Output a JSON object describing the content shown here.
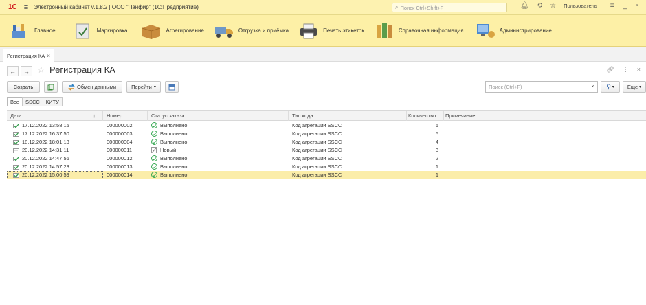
{
  "titlebar": {
    "logo": "1С",
    "title": "Электронный кабинет v.1.8.2 | ООО \"Панфир\" (1С:Предприятие)",
    "search_placeholder": "Поиск Ctrl+Shift+F",
    "user_label": "Пользователь"
  },
  "sections": [
    {
      "label": "Главное",
      "icon": "home-section-icon"
    },
    {
      "label": "Маркировка",
      "icon": "marking-section-icon"
    },
    {
      "label": "Агрегирование",
      "icon": "box-section-icon"
    },
    {
      "label": "Отгрузка и приёмка",
      "icon": "truck-section-icon"
    },
    {
      "label": "Печать этикеток",
      "icon": "printer-section-icon"
    },
    {
      "label": "Справочная информация",
      "icon": "books-section-icon"
    },
    {
      "label": "Администрирование",
      "icon": "admin-section-icon"
    }
  ],
  "tabs": [
    {
      "label": "Регистрация КА",
      "close": "×"
    }
  ],
  "form": {
    "title": "Регистрация КА",
    "back": "←",
    "forward": "→"
  },
  "toolbar": {
    "create": "Создать",
    "exchange": "Обмен данными",
    "goto": "Перейти",
    "search_placeholder": "Поиск (Ctrl+F)",
    "more": "Еще",
    "clear": "×"
  },
  "filters": [
    "Все",
    "SSCC",
    "КИТУ"
  ],
  "table": {
    "columns": [
      "Дата",
      "Номер",
      "Статус заказа",
      "Тип кода",
      "Количество",
      "Примечание"
    ],
    "sort_mark": "↓",
    "rows": [
      {
        "date": "17.12.2022 13:58:15",
        "number": "000000002",
        "status": "Выполнено",
        "status_kind": "done",
        "code_type": "Код агрегации SSCC",
        "qty": "5",
        "note": ""
      },
      {
        "date": "17.12.2022 16:37:50",
        "number": "000000003",
        "status": "Выполнено",
        "status_kind": "done",
        "code_type": "Код агрегации SSCC",
        "qty": "5",
        "note": ""
      },
      {
        "date": "18.12.2022 18:01:13",
        "number": "000000004",
        "status": "Выполнено",
        "status_kind": "done",
        "code_type": "Код агрегации SSCC",
        "qty": "4",
        "note": ""
      },
      {
        "date": "20.12.2022 14:31:11",
        "number": "000000011",
        "status": "Новый",
        "status_kind": "new",
        "code_type": "Код агрегации SSCC",
        "qty": "3",
        "note": ""
      },
      {
        "date": "20.12.2022 14:47:56",
        "number": "000000012",
        "status": "Выполнено",
        "status_kind": "done",
        "code_type": "Код агрегации SSCC",
        "qty": "2",
        "note": ""
      },
      {
        "date": "20.12.2022 14:57:23",
        "number": "000000013",
        "status": "Выполнено",
        "status_kind": "done",
        "code_type": "Код агрегации SSCC",
        "qty": "1",
        "note": ""
      },
      {
        "date": "20.12.2022 15:00:59",
        "number": "000000014",
        "status": "Выполнено",
        "status_kind": "done",
        "code_type": "Код агрегации SSCC",
        "qty": "1",
        "note": "",
        "selected": true
      }
    ]
  },
  "colors": {
    "accent_yellow": "#fdf0a6",
    "selected_row": "#fbeda9",
    "status_done": "#36a852",
    "logo_red": "#d21f1f"
  }
}
